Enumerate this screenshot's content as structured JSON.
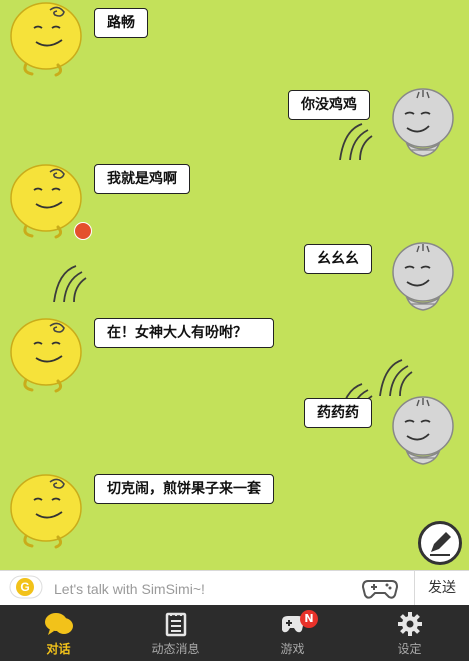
{
  "conversation": {
    "messages": [
      {
        "sender": "simsimi",
        "text": "路畅"
      },
      {
        "sender": "user",
        "text": "你没鸡鸡"
      },
      {
        "sender": "simsimi",
        "text": "我就是鸡啊"
      },
      {
        "sender": "user",
        "text": "幺幺幺"
      },
      {
        "sender": "simsimi",
        "text": "在！女神大人有吩咐？"
      },
      {
        "sender": "user",
        "text": "药药药"
      },
      {
        "sender": "simsimi",
        "text": "切克闹，煎饼果子来一套"
      }
    ]
  },
  "compose": {
    "placeholder": "Let's talk with SimSimi~!",
    "logo_letter": "G",
    "send_label": "发送"
  },
  "tabs": [
    {
      "label": "对话",
      "icon": "chat-bubbles-icon",
      "active": true
    },
    {
      "label": "动态消息",
      "icon": "notepad-icon",
      "active": false
    },
    {
      "label": "游戏",
      "icon": "gamepad-icon",
      "active": false,
      "badge": "N"
    },
    {
      "label": "设定",
      "icon": "gear-icon",
      "active": false
    }
  ],
  "colors": {
    "chat_background": "#c3e15a",
    "simsimi_yellow": "#f6e23a",
    "user_gray": "#d6d6d6",
    "tab_active": "#f2c21a",
    "tabbar_background": "#2c2c2c",
    "badge_red": "#e8322a"
  }
}
